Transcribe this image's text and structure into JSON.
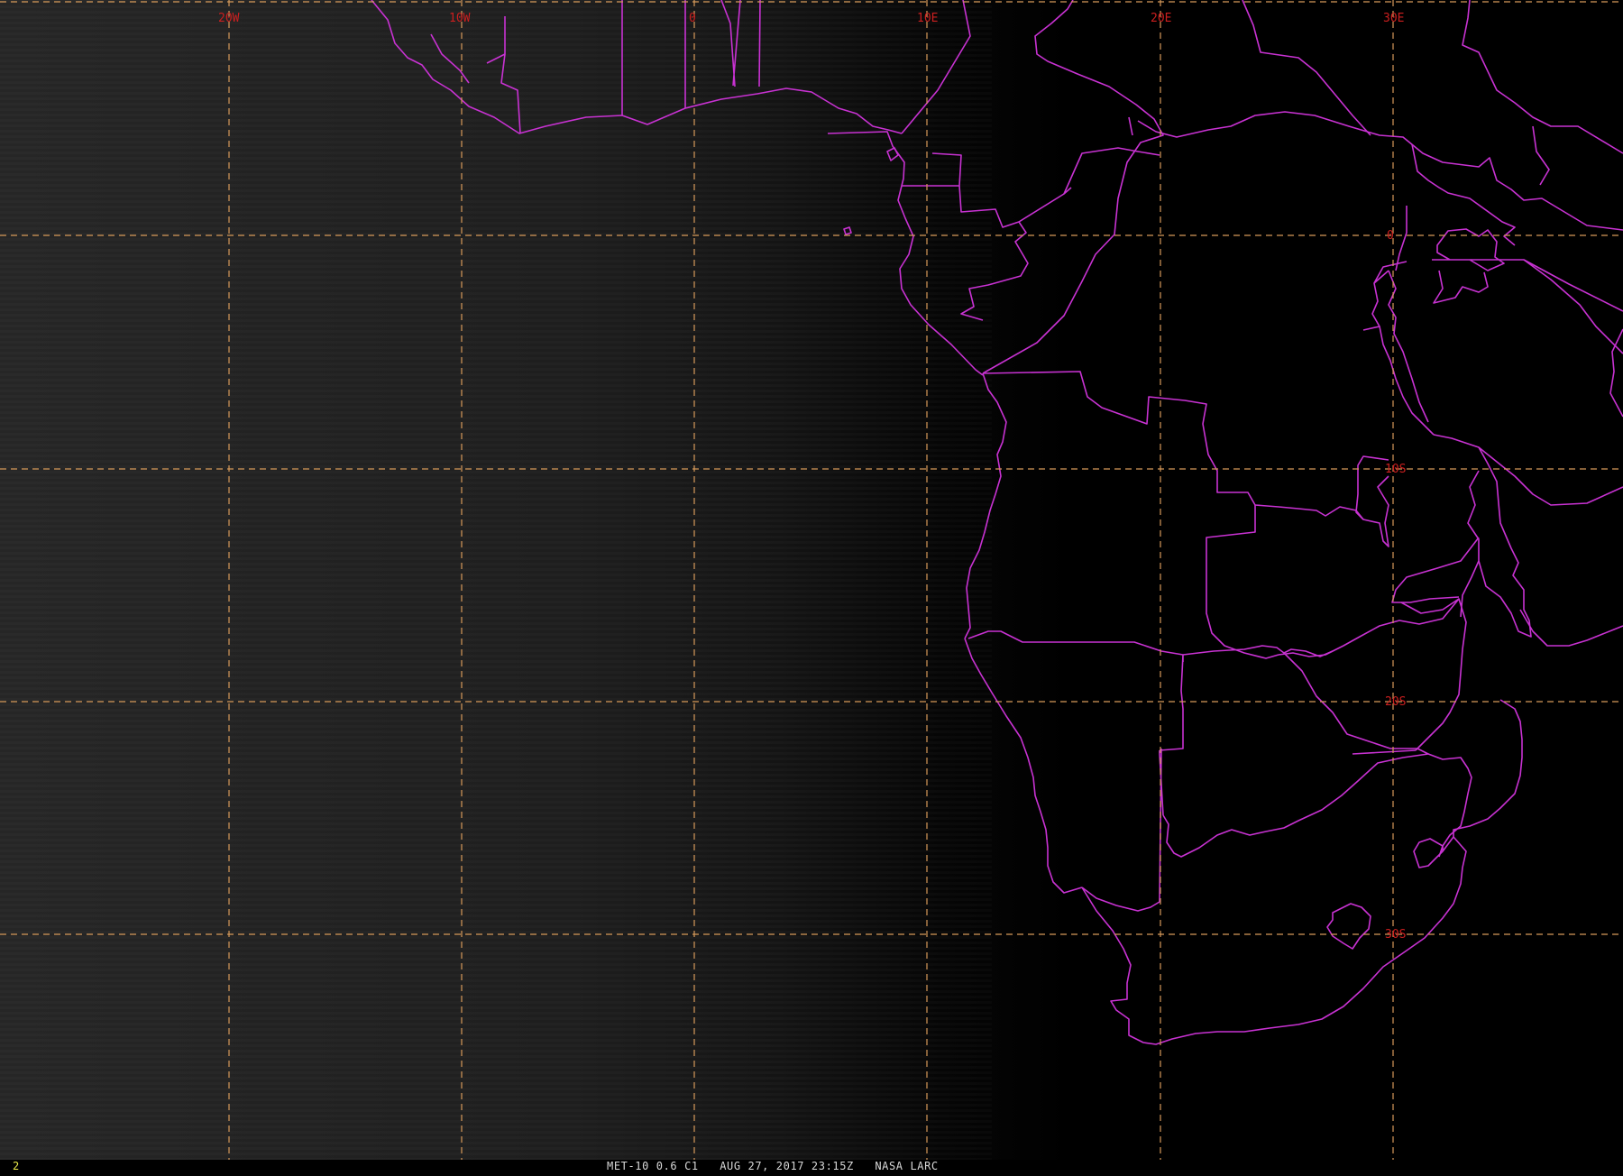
{
  "imagery": {
    "satellite": "MET-10",
    "channel_label": "0.6 C1",
    "date": "AUG 27, 2017",
    "time": "23:15Z",
    "producer": "NASA LARC",
    "frame_number": "2",
    "caption": "MET-10 0.6 C1   AUG 27, 2017 23:15Z   NASA LARC"
  },
  "map": {
    "projection_hint": "geostationary full-disk crop, southern Africa",
    "longitude_labels": [
      "20W",
      "10W",
      "0",
      "10E",
      "20E",
      "30E"
    ],
    "latitude_labels": [
      "0",
      "10S",
      "20S",
      "30S"
    ],
    "colors": {
      "background": "#000000",
      "gridline": "#d79a5a",
      "grid_label": "#cc1f1f",
      "political_borders": "#c832d2",
      "frame_number": "#e8e84a",
      "caption_text": "#d8d8d8"
    },
    "night_terminator_side": "west (sunlit glow fading toward east)"
  }
}
